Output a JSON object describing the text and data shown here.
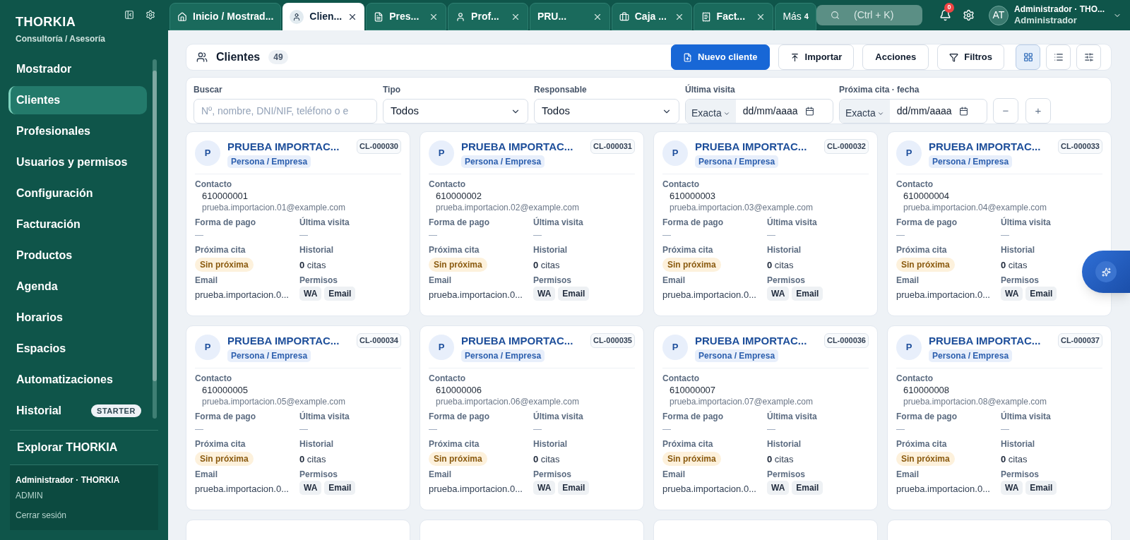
{
  "sidebar": {
    "brand": "THORKIA",
    "subtitle": "Consultoría / Asesoría",
    "items": [
      {
        "label": "Mostrador",
        "selected": false
      },
      {
        "label": "Clientes",
        "selected": true
      },
      {
        "label": "Profesionales",
        "selected": false
      },
      {
        "label": "Usuarios y permisos",
        "selected": false
      },
      {
        "label": "Configuración",
        "selected": false
      },
      {
        "label": "Facturación",
        "selected": false
      },
      {
        "label": "Productos",
        "selected": false
      },
      {
        "label": "Agenda",
        "selected": false
      },
      {
        "label": "Horarios",
        "selected": false
      },
      {
        "label": "Espacios",
        "selected": false
      },
      {
        "label": "Automatizaciones",
        "selected": false
      },
      {
        "label": "Historial",
        "selected": false,
        "badge": "STARTER"
      }
    ],
    "explore": "Explorar THORKIA",
    "user": {
      "name": "Administrador · THORKIA",
      "role": "ADMIN",
      "logout": "Cerrar sesión"
    }
  },
  "tabs": [
    {
      "kind": "home",
      "label": "Inicio / Mostrad...",
      "selected": false,
      "closable": false
    },
    {
      "kind": "user",
      "label": "Clien...",
      "selected": true,
      "closable": true
    },
    {
      "kind": "file",
      "label": "Pres...",
      "selected": false,
      "closable": true
    },
    {
      "kind": "user",
      "label": "Prof...",
      "selected": false,
      "closable": true
    },
    {
      "kind": "plain",
      "label": "PRU...",
      "selected": false,
      "closable": true
    },
    {
      "kind": "briefcase",
      "label": "Caja ...",
      "selected": false,
      "closable": true
    },
    {
      "kind": "receipt",
      "label": "Fact...",
      "selected": false,
      "closable": true
    }
  ],
  "more_tabs": {
    "label": "Más",
    "count": "4"
  },
  "topbar": {
    "search_placeholder": "(Ctrl + K)",
    "notifications": "0",
    "avatar": "AT",
    "user_name": "Administrador · THO...",
    "user_role": "Administrador"
  },
  "header": {
    "title": "Clientes",
    "count": "49",
    "buttons": [
      {
        "kind": "primary",
        "label": "Nuevo cliente"
      },
      {
        "kind": "import",
        "label": "Importar"
      },
      {
        "kind": "plain",
        "label": "Acciones"
      },
      {
        "kind": "filter",
        "label": "Filtros"
      }
    ],
    "views": [
      {
        "kind": "grid",
        "selected": true
      },
      {
        "kind": "list",
        "selected": false
      },
      {
        "kind": "settings",
        "selected": false
      }
    ]
  },
  "filters": {
    "search": {
      "label": "Buscar",
      "placeholder": "Nº, nombre, DNI/NIF, teléfono o e"
    },
    "type": {
      "label": "Tipo",
      "value": "Todos"
    },
    "owner": {
      "label": "Responsable",
      "value": "Todos"
    },
    "last_visit": {
      "label": "Última visita",
      "mode": "Exacta",
      "placeholder": "dd/mm/aaaa"
    },
    "next_date": {
      "label": "Próxima cita · fecha",
      "mode": "Exacta",
      "placeholder": "dd/mm/aaaa"
    },
    "zoom_out": "−",
    "zoom_in": "+"
  },
  "cards": [
    {
      "avatar": "P",
      "name": "PRUEBA IMPORTAC...",
      "code": "CL-000030",
      "type": "Persona / Empresa",
      "contact_label": "Contacto",
      "phone": "610000001",
      "contact_email": "prueba.importacion.01@example.com",
      "payment_label": "Forma de pago",
      "payment": "—",
      "last_label": "Última visita",
      "last": "—",
      "next_label": "Próxima cita",
      "next": "Sin próxima",
      "history_label": "Historial",
      "history_count": "0",
      "history_unit": "citas",
      "email_label": "Email",
      "email": "prueba.importacion.0...",
      "perms_label": "Permisos",
      "perms": [
        "WA",
        "Email"
      ]
    },
    {
      "avatar": "P",
      "name": "PRUEBA IMPORTAC...",
      "code": "CL-000031",
      "type": "Persona / Empresa",
      "contact_label": "Contacto",
      "phone": "610000002",
      "contact_email": "prueba.importacion.02@example.com",
      "payment_label": "Forma de pago",
      "payment": "—",
      "last_label": "Última visita",
      "last": "—",
      "next_label": "Próxima cita",
      "next": "Sin próxima",
      "history_label": "Historial",
      "history_count": "0",
      "history_unit": "citas",
      "email_label": "Email",
      "email": "prueba.importacion.0...",
      "perms_label": "Permisos",
      "perms": [
        "WA",
        "Email"
      ]
    },
    {
      "avatar": "P",
      "name": "PRUEBA IMPORTAC...",
      "code": "CL-000032",
      "type": "Persona / Empresa",
      "contact_label": "Contacto",
      "phone": "610000003",
      "contact_email": "prueba.importacion.03@example.com",
      "payment_label": "Forma de pago",
      "payment": "—",
      "last_label": "Última visita",
      "last": "—",
      "next_label": "Próxima cita",
      "next": "Sin próxima",
      "history_label": "Historial",
      "history_count": "0",
      "history_unit": "citas",
      "email_label": "Email",
      "email": "prueba.importacion.0...",
      "perms_label": "Permisos",
      "perms": [
        "WA",
        "Email"
      ]
    },
    {
      "avatar": "P",
      "name": "PRUEBA IMPORTAC...",
      "code": "CL-000033",
      "type": "Persona / Empresa",
      "contact_label": "Contacto",
      "phone": "610000004",
      "contact_email": "prueba.importacion.04@example.com",
      "payment_label": "Forma de pago",
      "payment": "—",
      "last_label": "Última visita",
      "last": "—",
      "next_label": "Próxima cita",
      "next": "Sin próxima",
      "history_label": "Historial",
      "history_count": "0",
      "history_unit": "citas",
      "email_label": "Email",
      "email": "prueba.importacion.0...",
      "perms_label": "Permisos",
      "perms": [
        "WA",
        "Email"
      ]
    },
    {
      "avatar": "P",
      "name": "PRUEBA IMPORTAC...",
      "code": "CL-000034",
      "type": "Persona / Empresa",
      "contact_label": "Contacto",
      "phone": "610000005",
      "contact_email": "prueba.importacion.05@example.com",
      "payment_label": "Forma de pago",
      "payment": "—",
      "last_label": "Última visita",
      "last": "—",
      "next_label": "Próxima cita",
      "next": "Sin próxima",
      "history_label": "Historial",
      "history_count": "0",
      "history_unit": "citas",
      "email_label": "Email",
      "email": "prueba.importacion.0...",
      "perms_label": "Permisos",
      "perms": [
        "WA",
        "Email"
      ]
    },
    {
      "avatar": "P",
      "name": "PRUEBA IMPORTAC...",
      "code": "CL-000035",
      "type": "Persona / Empresa",
      "contact_label": "Contacto",
      "phone": "610000006",
      "contact_email": "prueba.importacion.06@example.com",
      "payment_label": "Forma de pago",
      "payment": "—",
      "last_label": "Última visita",
      "last": "—",
      "next_label": "Próxima cita",
      "next": "Sin próxima",
      "history_label": "Historial",
      "history_count": "0",
      "history_unit": "citas",
      "email_label": "Email",
      "email": "prueba.importacion.0...",
      "perms_label": "Permisos",
      "perms": [
        "WA",
        "Email"
      ]
    },
    {
      "avatar": "P",
      "name": "PRUEBA IMPORTAC...",
      "code": "CL-000036",
      "type": "Persona / Empresa",
      "contact_label": "Contacto",
      "phone": "610000007",
      "contact_email": "prueba.importacion.07@example.com",
      "payment_label": "Forma de pago",
      "payment": "—",
      "last_label": "Última visita",
      "last": "—",
      "next_label": "Próxima cita",
      "next": "Sin próxima",
      "history_label": "Historial",
      "history_count": "0",
      "history_unit": "citas",
      "email_label": "Email",
      "email": "prueba.importacion.0...",
      "perms_label": "Permisos",
      "perms": [
        "WA",
        "Email"
      ]
    },
    {
      "avatar": "P",
      "name": "PRUEBA IMPORTAC...",
      "code": "CL-000037",
      "type": "Persona / Empresa",
      "contact_label": "Contacto",
      "phone": "610000008",
      "contact_email": "prueba.importacion.08@example.com",
      "payment_label": "Forma de pago",
      "payment": "—",
      "last_label": "Última visita",
      "last": "—",
      "next_label": "Próxima cita",
      "next": "Sin próxima",
      "history_label": "Historial",
      "history_count": "0",
      "history_unit": "citas",
      "email_label": "Email",
      "email": "prueba.importacion.0...",
      "perms_label": "Permisos",
      "perms": [
        "WA",
        "Email"
      ]
    }
  ]
}
